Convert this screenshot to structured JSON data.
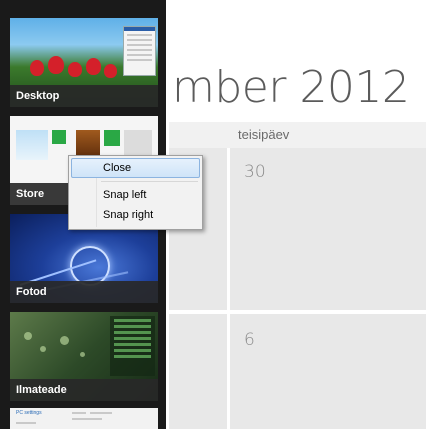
{
  "calendar": {
    "title": "mber 2012",
    "day_header": "teisipäev",
    "cells": [
      {
        "day": "30"
      },
      {
        "day": "6"
      }
    ]
  },
  "switcher": {
    "apps": [
      {
        "label": "Desktop"
      },
      {
        "label": "Store"
      },
      {
        "label": "Fotod"
      },
      {
        "label": "Ilmateade"
      }
    ],
    "partial_app_text": "PC settings"
  },
  "context_menu": {
    "items": [
      {
        "label": "Close",
        "highlighted": true
      },
      {
        "label": "Snap left"
      },
      {
        "label": "Snap right"
      }
    ]
  },
  "colors": {
    "panel": "#1a1a1a",
    "menu_highlight": "#cfe4f8",
    "calendar_cell": "#e8e8e8"
  }
}
